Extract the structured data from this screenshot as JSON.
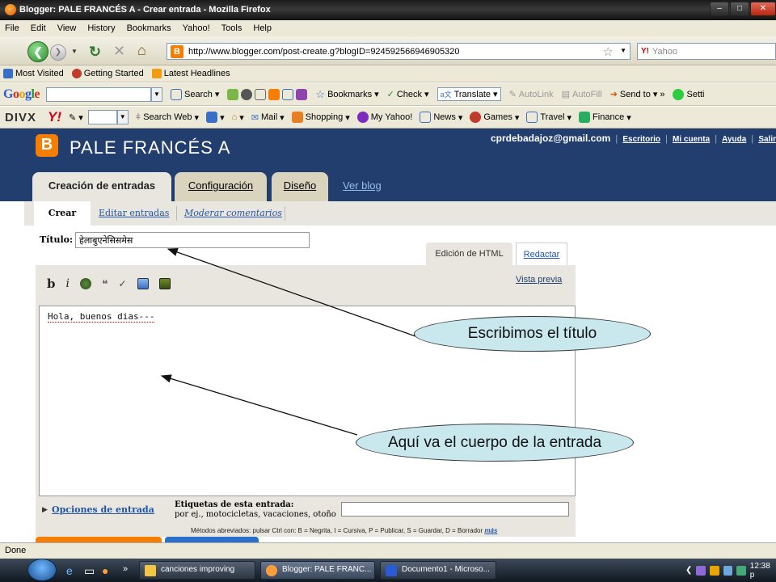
{
  "window": {
    "title": "Blogger: PALE FRANCÉS A - Crear entrada - Mozilla Firefox",
    "minimize": "–",
    "maximize": "□",
    "close": "✕"
  },
  "menu": [
    "File",
    "Edit",
    "View",
    "History",
    "Bookmarks",
    "Yahoo!",
    "Tools",
    "Help"
  ],
  "navbar": {
    "url": "http://www.blogger.com/post-create.g?blogID=924592566946905320",
    "search_engine": "Y!",
    "search_placeholder": "Yahoo"
  },
  "bookmarks": [
    "Most Visited",
    "Getting Started",
    "Latest Headlines"
  ],
  "google_toolbar": {
    "logo": [
      "G",
      "o",
      "o",
      "g",
      "l",
      "e"
    ],
    "search": "Search",
    "bookmarks": "Bookmarks",
    "check": "Check",
    "translate": "Translate",
    "autolink": "AutoLink",
    "autofill": "AutoFill",
    "sendto": "Send to",
    "more": "»",
    "settings": "Setti"
  },
  "yahoo_toolbar": {
    "divx": "DIVX",
    "yahoo": "Y!",
    "search_web": "Search Web",
    "items": [
      "Mail",
      "Shopping",
      "My Yahoo!",
      "News",
      "Games",
      "Travel",
      "Finance"
    ]
  },
  "blogger": {
    "logo": "B",
    "blog_title": "PALE FRANCÉS A",
    "email": "cprdebadajoz@gmail.com",
    "links": [
      "Escritorio",
      "Mi cuenta",
      "Ayuda",
      "Salir"
    ],
    "tabs": {
      "active": "Creación de entradas",
      "config": "Configuración",
      "design": "Diseño",
      "view": "Ver blog"
    },
    "subnav": {
      "crear": "Crear",
      "editar": "Editar entradas",
      "moderar": "Moderar comentarios"
    },
    "title_label": "Título:",
    "title_value": "हेलाबुएनेसिसमेस",
    "mode_html": "Edición de HTML",
    "mode_compose": "Redactar",
    "toolbar": {
      "bold": "b",
      "italic": "i",
      "quote": "❝"
    },
    "preview": "Vista previa",
    "body_text": "Hola, buenos dias---",
    "options_link": "Opciones de entrada",
    "tags_label": "Etiquetas de esta entrada:",
    "tags_example": "por ej., motocicletas, vacaciones, otoño",
    "shortcuts": "Métodos abreviados: pulsar Ctrl con: B = Negrita, I = Cursiva, P = Publicar, S = Guardar, D = Borrador",
    "shortcuts_more": "más"
  },
  "callouts": {
    "title": "Escribimos el título",
    "body": "Aquí va el cuerpo de la entrada"
  },
  "status": "Done",
  "taskbar": {
    "tasks": [
      "canciones improving",
      "Blogger: PALE FRANC...",
      "Documento1 - Microso..."
    ],
    "clock": "12:38 p"
  },
  "colors": {
    "blogger_header": "#223e6e",
    "blogger_orange": "#f57d00",
    "callout_fill": "#c8e8ee"
  }
}
